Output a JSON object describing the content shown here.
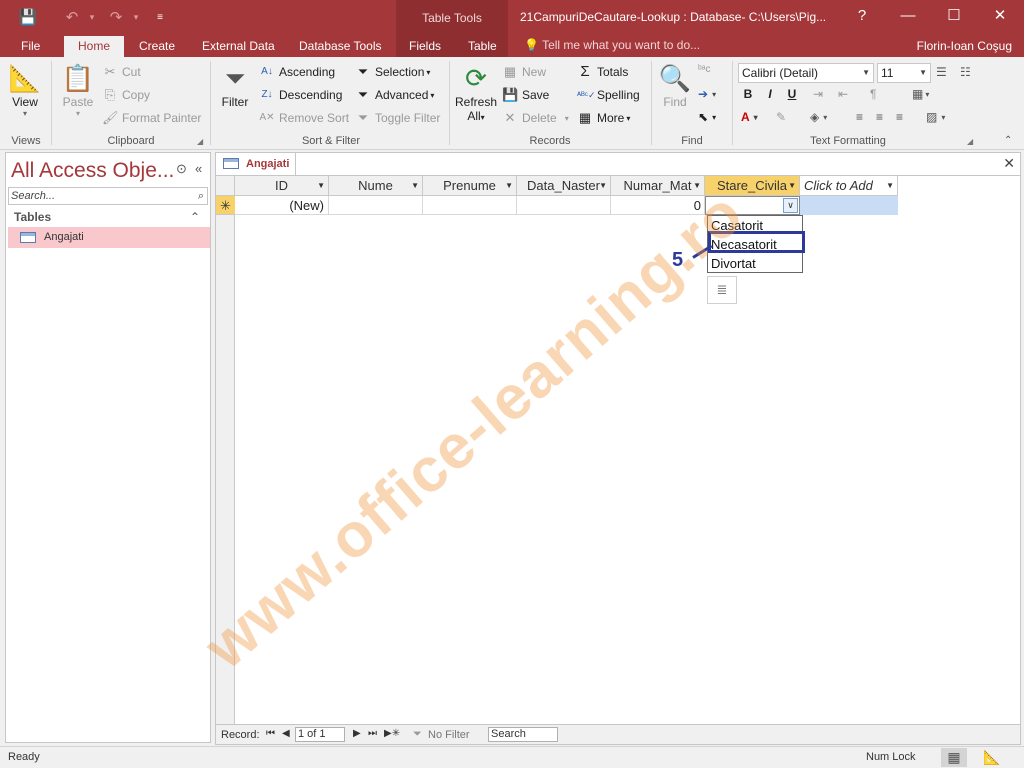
{
  "title_bar": {
    "window_title": "21CampuriDeCautare-Lookup : Database- C:\\Users\\Pig...",
    "contextual_group": "Table Tools",
    "help": "?",
    "minimize": "—",
    "maximize": "☐",
    "close": "✕"
  },
  "tabs": {
    "file": "File",
    "home": "Home",
    "create": "Create",
    "external_data": "External Data",
    "database_tools": "Database Tools",
    "fields": "Fields",
    "table": "Table",
    "tell_me": "Tell me what you want to do...",
    "user": "Florin-Ioan Coşug"
  },
  "ribbon": {
    "views": {
      "view": "View",
      "label": "Views"
    },
    "clipboard": {
      "paste": "Paste",
      "cut": "Cut",
      "copy": "Copy",
      "format_painter": "Format Painter",
      "label": "Clipboard"
    },
    "sort_filter": {
      "filter": "Filter",
      "ascending": "Ascending",
      "descending": "Descending",
      "remove_sort": "Remove Sort",
      "selection": "Selection",
      "advanced": "Advanced",
      "toggle_filter": "Toggle Filter",
      "label": "Sort & Filter"
    },
    "records": {
      "refresh": "Refresh",
      "refresh_all": "All",
      "new": "New",
      "save": "Save",
      "delete": "Delete",
      "totals": "Totals",
      "spelling": "Spelling",
      "more": "More",
      "label": "Records"
    },
    "find": {
      "find": "Find",
      "label": "Find"
    },
    "text_formatting": {
      "font": "Calibri (Detail)",
      "size": "11",
      "bold": "B",
      "italic": "I",
      "underline": "U",
      "label": "Text Formatting"
    }
  },
  "nav_pane": {
    "title": "All Access Obje...",
    "search_placeholder": "Search...",
    "section": "Tables",
    "items": [
      {
        "label": "Angajati"
      }
    ]
  },
  "document": {
    "tab_label": "Angajati",
    "columns": [
      "ID",
      "Nume",
      "Prenume",
      "Data_Naster",
      "Numar_Mat",
      "Stare_Civila",
      "Click to Add"
    ],
    "new_row": {
      "id": "(New)",
      "numar_mat": "0",
      "marker": "✳"
    },
    "dropdown_options": [
      "Casatorit",
      "Necasatorit",
      "Divortat"
    ],
    "highlighted_option": "Necasatorit",
    "callout_number": "5"
  },
  "record_nav": {
    "label": "Record:",
    "position": "1 of 1",
    "filter_status": "No Filter",
    "search": "Search"
  },
  "status_bar": {
    "ready": "Ready",
    "num_lock": "Num Lock"
  },
  "watermark": "www.office-learning.ro",
  "colors": {
    "brand": "#a4373a",
    "selected_header": "#f7d26a",
    "callout": "#2e3a9a",
    "nav_item_selected": "#f8c8cc"
  }
}
